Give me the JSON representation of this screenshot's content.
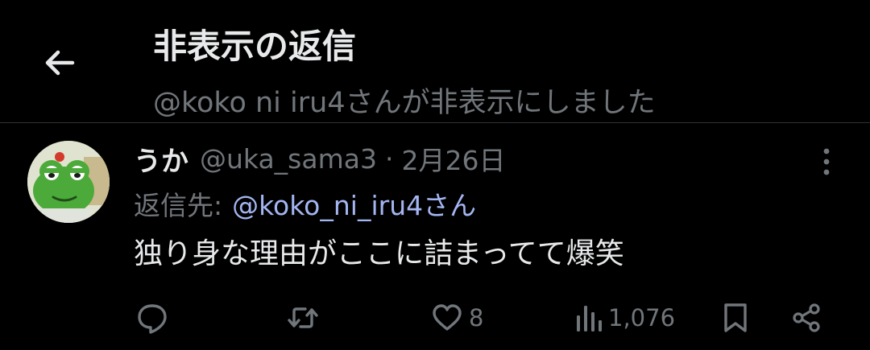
{
  "header": {
    "back_icon": "arrow-left-icon",
    "title": "非表示の返信",
    "subtitle": "@koko ni iru4さんが非表示にしました"
  },
  "tweet": {
    "display_name": "うか",
    "handle": "@uka_sama3",
    "separator": "·",
    "date": "2月26日",
    "reply_prefix": "返信先:",
    "reply_to": "@koko_ni_iru4さん",
    "text": "独り身な理由がここに詰まってて爆笑",
    "avatar_icon": "frog-character-avatar",
    "more_icon": "more-vertical-icon"
  },
  "actions": {
    "reply_icon": "reply-bubble-icon",
    "retweet_icon": "retweet-icon",
    "like_icon": "heart-icon",
    "like_count": "8",
    "views_icon": "views-bars-icon",
    "views_count": "1,076",
    "bookmark_icon": "bookmark-icon",
    "share_icon": "share-icon"
  },
  "colors": {
    "background": "#000000",
    "primary_text": "#e7e9ea",
    "secondary_text": "#71767b",
    "mention_link": "#a4b6f2",
    "divider": "#2f3336"
  }
}
